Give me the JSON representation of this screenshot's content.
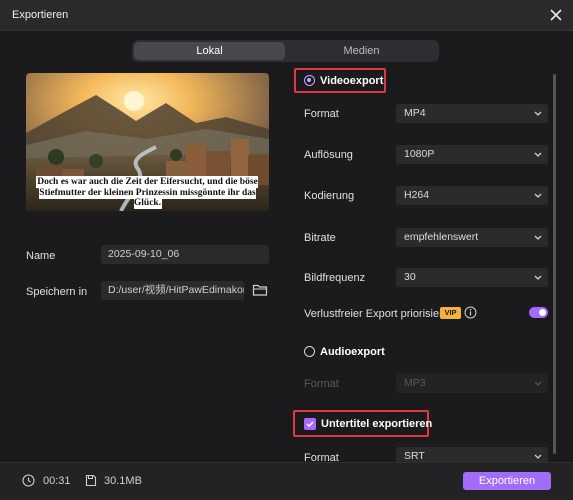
{
  "window": {
    "title": "Exportieren"
  },
  "tabs": [
    {
      "label": "Lokal",
      "active": true
    },
    {
      "label": "Medien",
      "active": false
    }
  ],
  "preview": {
    "subtitle_text": "Doch es war auch die Zeit der Eifersucht, und die böse Stiefmutter der kleinen Prinzessin missgönnte ihr das Glück."
  },
  "left_form": {
    "name_label": "Name",
    "name_value": "2025-09-10_06",
    "save_label": "Speichern in",
    "save_path": "D:/user/视频/HitPawEdimakor"
  },
  "video_export": {
    "label": "Videoexport",
    "selected": true,
    "rows": [
      {
        "label": "Format",
        "value": "MP4"
      },
      {
        "label": "Auflösung",
        "value": "1080P"
      },
      {
        "label": "Kodierung",
        "value": "H264"
      },
      {
        "label": "Bitrate",
        "value": "empfehlenswert"
      },
      {
        "label": "Bildfrequenz",
        "value": "30"
      }
    ],
    "lossless_label": "Verlustfreier Export priorisiert",
    "vip_badge": "VIP",
    "lossless_enabled": true
  },
  "audio_export": {
    "label": "Audioexport",
    "selected": false,
    "format_label": "Format",
    "format_value": "MP3"
  },
  "subtitle_export": {
    "label": "Untertitel exportieren",
    "checked": true,
    "format_label": "Format",
    "format_value": "SRT"
  },
  "footer": {
    "duration": "00:31",
    "size": "30.1MB",
    "export_button": "Exportieren"
  },
  "colors": {
    "accent": "#a16cf8",
    "highlight_border": "#e0393e",
    "vip": "#f5b23b",
    "background": "#1b1b1e"
  }
}
